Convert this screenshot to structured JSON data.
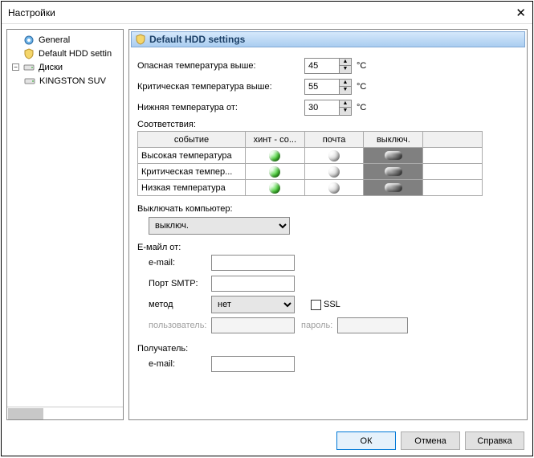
{
  "title": "Настройки",
  "tree": {
    "general": "General",
    "defhdd": "Default HDD settin",
    "disks": "Диски",
    "disk0": "KINGSTON SUV"
  },
  "header": "Default HDD settings",
  "temps": {
    "danger_label": "Опасная температура выше:",
    "critical_label": "Критическая температура выше:",
    "lower_label": "Нижняя температура от:",
    "danger_value": "45",
    "critical_value": "55",
    "lower_value": "30",
    "unit": "°C"
  },
  "grid": {
    "heading": "Соответствия:",
    "col_event": "событие",
    "col_hint": "хинт - со...",
    "col_mail": "почта",
    "col_off": "выключ.",
    "row1": "Высокая температура",
    "row2": "Критическая темпер...",
    "row3": "Низкая температура"
  },
  "shutdown": {
    "label": "Выключать компьютер:",
    "value": "выключ."
  },
  "email": {
    "from_label": "Е-майл от:",
    "email_label": "e-mail:",
    "port_label": "Порт SMTP:",
    "method_label": "метод",
    "method_value": "нет",
    "ssl_label": "SSL",
    "user_label": "пользователь:",
    "pass_label": "пароль:",
    "recipient_label": "Получатель:",
    "rec_email_label": "e-mail:"
  },
  "buttons": {
    "ok": "ОК",
    "cancel": "Отмена",
    "help": "Справка"
  }
}
